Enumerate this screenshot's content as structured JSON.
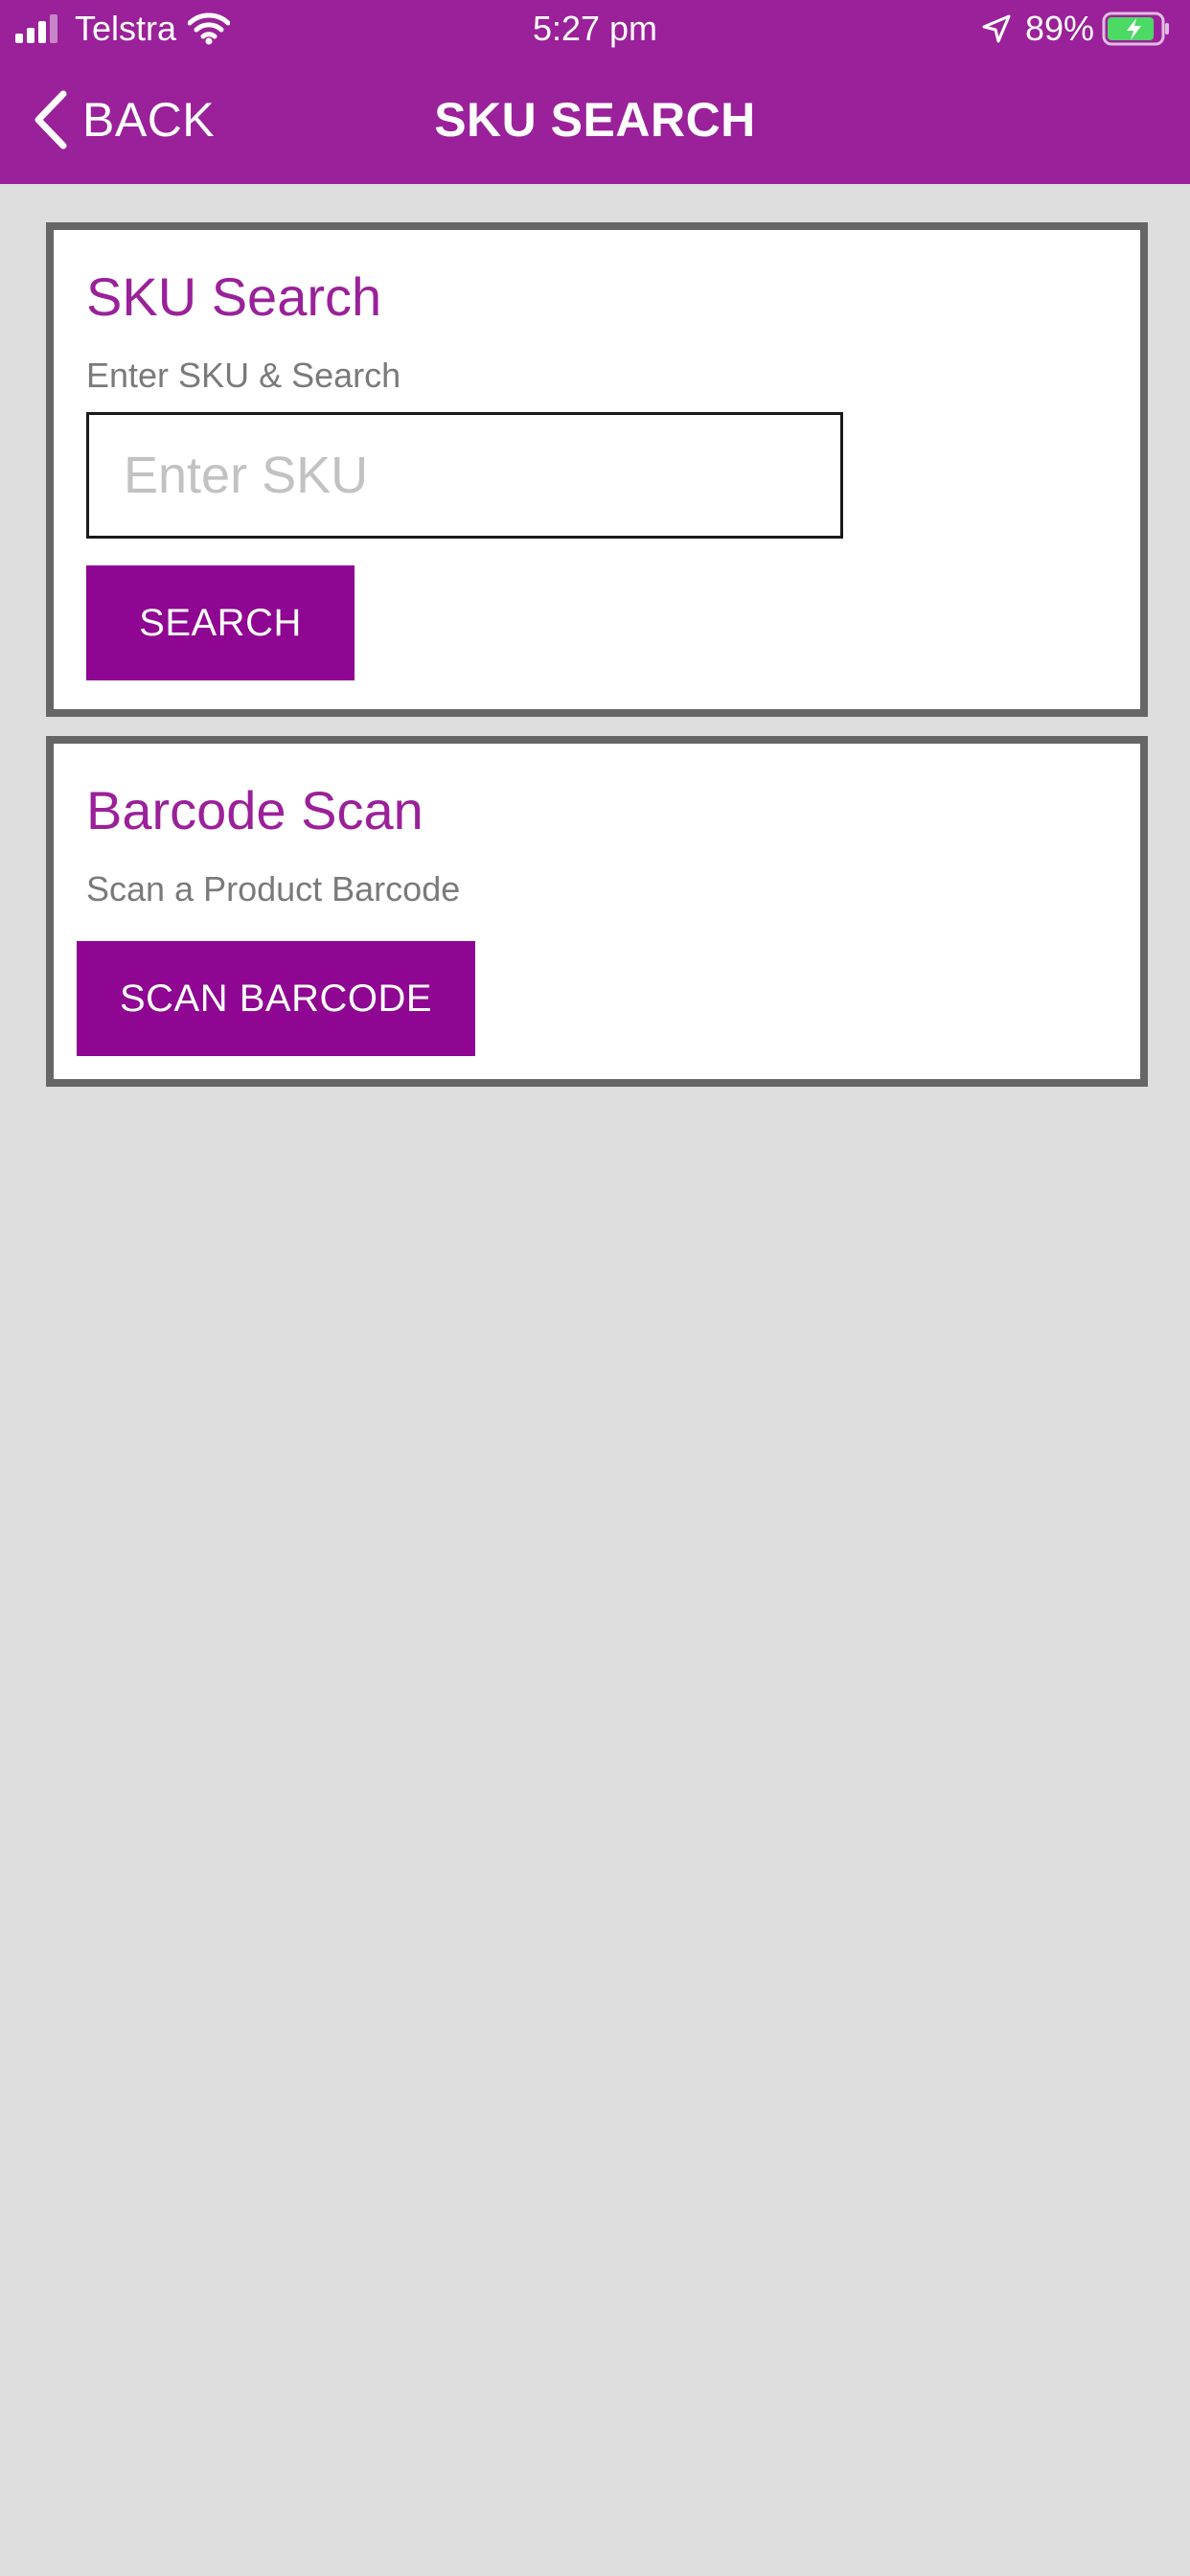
{
  "status_bar": {
    "carrier": "Telstra",
    "time": "5:27 pm",
    "battery_percent": "89%",
    "battery_level": 0.89,
    "icons": {
      "signal": "signal-icon",
      "wifi": "wifi-icon",
      "location": "location-arrow-icon",
      "battery": "battery-charging-icon"
    }
  },
  "nav": {
    "back_label": "BACK",
    "title": "SKU SEARCH",
    "back_icon": "chevron-left-icon"
  },
  "sku_card": {
    "title": "SKU Search",
    "subtitle": "Enter SKU & Search",
    "input_placeholder": "Enter SKU",
    "input_value": "",
    "button_label": "SEARCH"
  },
  "barcode_card": {
    "title": "Barcode Scan",
    "subtitle": "Scan a Product Barcode",
    "button_label": "SCAN BARCODE"
  },
  "colors": {
    "header": "#9a2199",
    "accent": "#8e0691",
    "title_text": "#9a2199",
    "card_border": "#666666",
    "background": "#dedede",
    "battery_fill": "#4cd964"
  }
}
